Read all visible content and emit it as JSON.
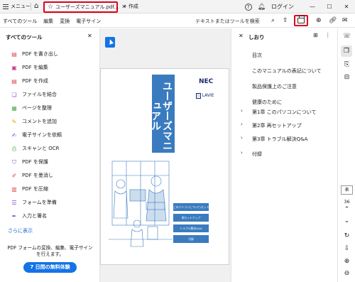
{
  "titlebar": {
    "menu_label": "メニュー",
    "tab_title": "ユーザーズマニュアル.pdf...",
    "new_tab_label": "作成",
    "login_label": "ログイン"
  },
  "toolbar": {
    "menus": [
      "すべてのツール",
      "編集",
      "変換",
      "電子サイン"
    ],
    "search_text": "テキストまたはツールを検索"
  },
  "tools_panel": {
    "title": "すべてのツール",
    "items": [
      {
        "label": "PDF を書き出し",
        "icon": "export-pdf-icon",
        "color": "#e0444c"
      },
      {
        "label": "PDF を編集",
        "icon": "edit-pdf-icon",
        "color": "#c93b8e"
      },
      {
        "label": "PDF を作成",
        "icon": "create-pdf-icon",
        "color": "#e0444c"
      },
      {
        "label": "ファイルを結合",
        "icon": "combine-files-icon",
        "color": "#8a4fd1"
      },
      {
        "label": "ページを整理",
        "icon": "organize-pages-icon",
        "color": "#4caf50"
      },
      {
        "label": "コメントを追加",
        "icon": "comment-icon",
        "color": "#e6a100"
      },
      {
        "label": "電子サインを依頼",
        "icon": "request-signature-icon",
        "color": "#8a4fd1"
      },
      {
        "label": "スキャンと OCR",
        "icon": "scan-ocr-icon",
        "color": "#4caf50"
      },
      {
        "label": "PDF を保護",
        "icon": "protect-pdf-icon",
        "color": "#8a4fd1"
      },
      {
        "label": "PDF を墨消し",
        "icon": "redact-pdf-icon",
        "color": "#e0444c"
      },
      {
        "label": "PDF を圧縮",
        "icon": "compress-pdf-icon",
        "color": "#e0444c"
      },
      {
        "label": "フォームを準備",
        "icon": "prepare-form-icon",
        "color": "#8a4fd1"
      },
      {
        "label": "入力と署名",
        "icon": "fill-sign-icon",
        "color": "#8a4fd1"
      }
    ],
    "more_label": "さらに表示",
    "promo_text": "PDF フォームの変換、編集、電子サインを行えます。",
    "trial_button": "7 日間の無料体験"
  },
  "document": {
    "cover_title": "ユーザーズマニュアル",
    "brand": "NEC",
    "sub_brand": "LAVIE",
    "cover_labels": [
      "このパソコンについて/セットアップ",
      "再セットアップ",
      "トラブル解決Q&A",
      "付録"
    ]
  },
  "bookmarks": {
    "title": "しおり",
    "items": [
      {
        "label": "目次",
        "expandable": false
      },
      {
        "label": "このマニュアルの表記について",
        "expandable": false
      },
      {
        "label": "製品保護上のご注意",
        "expandable": false
      },
      {
        "label": "健康のために",
        "expandable": false
      },
      {
        "label": "第1章 このパソコンについて",
        "expandable": true
      },
      {
        "label": "第2章 再セットアップ",
        "expandable": true
      },
      {
        "label": "第3章 トラブル解決Q&A",
        "expandable": true
      },
      {
        "label": "付録",
        "expandable": true
      }
    ]
  },
  "rail": {
    "page_box": "表",
    "total_pages": "36",
    "zoom_minus": "−"
  },
  "colors": {
    "accent": "#1473e6",
    "highlight": "#e0001b",
    "cover_blue": "#3a7bbf"
  }
}
